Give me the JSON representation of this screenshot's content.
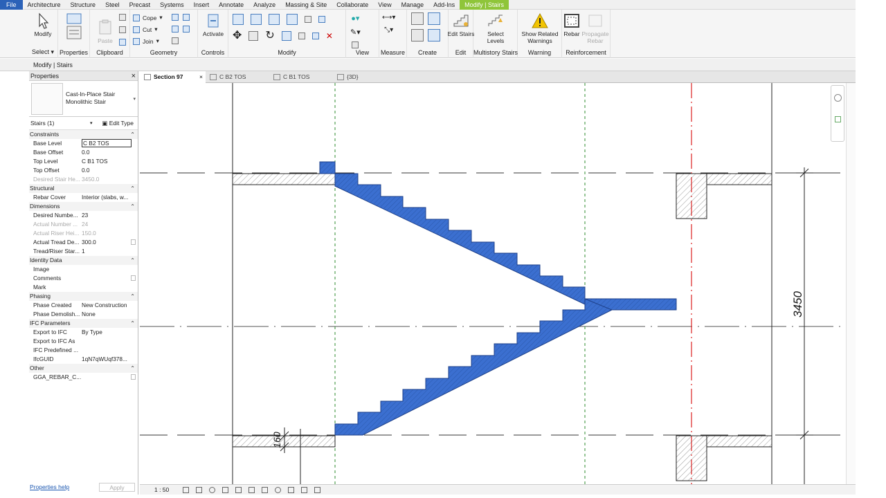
{
  "menu": {
    "tabs": [
      "File",
      "Architecture",
      "Structure",
      "Steel",
      "Precast",
      "Systems",
      "Insert",
      "Annotate",
      "Analyze",
      "Massing & Site",
      "Collaborate",
      "View",
      "Manage",
      "Add-Ins",
      "Modify | Stairs"
    ]
  },
  "ribbon": {
    "select": {
      "button": "Modify",
      "label": "Select"
    },
    "properties": {
      "label": "Properties"
    },
    "clipboard": {
      "paste": "Paste",
      "label": "Clipboard"
    },
    "geometry": {
      "cope": "Cope",
      "cut": "Cut",
      "join": "Join",
      "label": "Geometry"
    },
    "controls": {
      "activate": "Activate",
      "label": "Controls"
    },
    "modify": {
      "label": "Modify"
    },
    "view": {
      "label": "View"
    },
    "measure": {
      "label": "Measure"
    },
    "create": {
      "label": "Create"
    },
    "edit": {
      "button": "Edit Stairs",
      "label": "Edit"
    },
    "multistory": {
      "button": "Select Levels",
      "label": "Multistory Stairs"
    },
    "warning": {
      "button": "Show Related Warnings",
      "label": "Warning"
    },
    "reinforcement": {
      "rebar": "Rebar",
      "propagate": "Propagate Rebar",
      "label": "Reinforcement"
    }
  },
  "options_bar": {
    "text": "Modify | Stairs"
  },
  "properties": {
    "title": "Properties",
    "type_name": [
      "Cast-In-Place Stair",
      "Monolithic Stair"
    ],
    "instance": "Stairs (1)",
    "edit_type": "Edit Type",
    "rows": [
      {
        "group": "Constraints"
      },
      {
        "k": "Base Level",
        "v": "C B2 TOS",
        "boxed": true
      },
      {
        "k": "Base Offset",
        "v": "0.0"
      },
      {
        "k": "Top Level",
        "v": "C B1 TOS"
      },
      {
        "k": "Top Offset",
        "v": "0.0"
      },
      {
        "k": "Desired Stair He...",
        "v": "3450.0",
        "muted": true
      },
      {
        "group": "Structural"
      },
      {
        "k": "Rebar Cover",
        "v": "Interior (slabs, w..."
      },
      {
        "group": "Dimensions"
      },
      {
        "k": "Desired Numbe...",
        "v": "23"
      },
      {
        "k": "Actual Number ...",
        "v": "24",
        "muted": true
      },
      {
        "k": "Actual Riser Hei...",
        "v": "150.0",
        "muted": true
      },
      {
        "k": "Actual Tread De...",
        "v": "300.0",
        "check": true
      },
      {
        "k": "Tread/Riser Star...",
        "v": "1"
      },
      {
        "group": "Identity Data"
      },
      {
        "k": "Image",
        "v": ""
      },
      {
        "k": "Comments",
        "v": "",
        "check": true
      },
      {
        "k": "Mark",
        "v": ""
      },
      {
        "group": "Phasing"
      },
      {
        "k": "Phase Created",
        "v": "New Construction"
      },
      {
        "k": "Phase Demolish...",
        "v": "None"
      },
      {
        "group": "IFC Parameters"
      },
      {
        "k": "Export to IFC",
        "v": "By Type"
      },
      {
        "k": "Export to IFC As",
        "v": ""
      },
      {
        "k": "IFC Predefined ...",
        "v": ""
      },
      {
        "k": "IfcGUID",
        "v": "1qN7qWUqf378..."
      },
      {
        "group": "Other"
      },
      {
        "k": "GGA_REBAR_C...",
        "v": "",
        "check": true
      }
    ],
    "help": "Properties help",
    "apply": "Apply"
  },
  "view_tabs": [
    {
      "label": "Section 97",
      "active": true
    },
    {
      "label": "C B2 TOS"
    },
    {
      "label": "C B1 TOS"
    },
    {
      "label": "{3D}"
    }
  ],
  "drawing": {
    "dim_total": "3450",
    "dim_slab": "160"
  },
  "status": {
    "scale": "1 : 50"
  }
}
